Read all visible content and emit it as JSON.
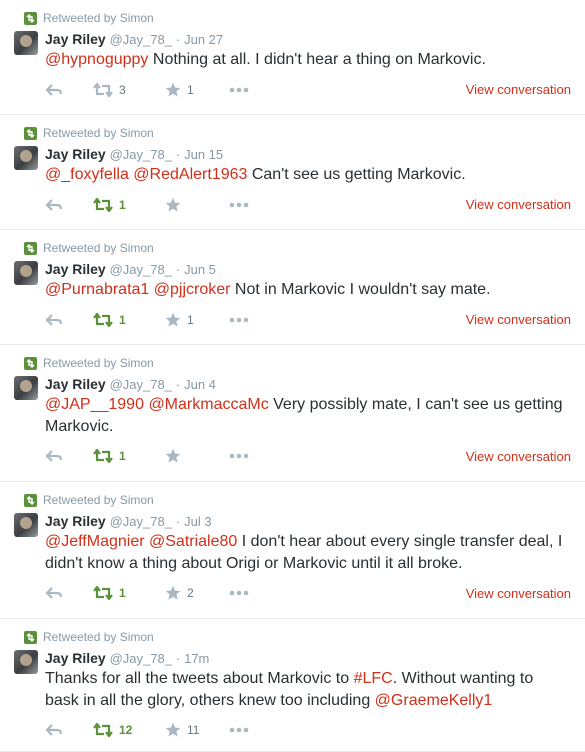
{
  "colors": {
    "link": "#d0301a",
    "muted": "#8899a6",
    "retweet_on": "#5c913b",
    "icon": "#aab8c2"
  },
  "icons": {
    "retweet_context": "retweet-icon",
    "reply": "reply-icon",
    "retweet": "retweet-icon",
    "favorite": "star-icon",
    "more": "more-dots-icon"
  },
  "tweets": [
    {
      "retweeted_by": "Retweeted by Simon",
      "fullname": "Jay Riley",
      "username": "@Jay_78_",
      "sep": "·",
      "time": "Jun 27",
      "parts": [
        {
          "t": "@hypnoguppy",
          "m": true
        },
        {
          "t": " Nothing at all. I didn't hear a thing on Markovic.",
          "m": false
        }
      ],
      "retweets": "3",
      "favorites": "1",
      "retweeted": false,
      "view_conversation": "View conversation"
    },
    {
      "retweeted_by": "Retweeted by Simon",
      "fullname": "Jay Riley",
      "username": "@Jay_78_",
      "sep": "·",
      "time": "Jun 15",
      "parts": [
        {
          "t": "@_foxyfella",
          "m": true
        },
        {
          "t": " ",
          "m": false
        },
        {
          "t": "@RedAlert1963",
          "m": true
        },
        {
          "t": " Can't see us getting Markovic.",
          "m": false
        }
      ],
      "retweets": "1",
      "favorites": "",
      "retweeted": true,
      "view_conversation": "View conversation"
    },
    {
      "retweeted_by": "Retweeted by Simon",
      "fullname": "Jay Riley",
      "username": "@Jay_78_",
      "sep": "·",
      "time": "Jun 5",
      "parts": [
        {
          "t": "@Purnabrata1",
          "m": true
        },
        {
          "t": " ",
          "m": false
        },
        {
          "t": "@pjjcroker",
          "m": true
        },
        {
          "t": " Not in Markovic I wouldn't say mate.",
          "m": false
        }
      ],
      "retweets": "1",
      "favorites": "1",
      "retweeted": true,
      "view_conversation": "View conversation"
    },
    {
      "retweeted_by": "Retweeted by Simon",
      "fullname": "Jay Riley",
      "username": "@Jay_78_",
      "sep": "·",
      "time": "Jun 4",
      "parts": [
        {
          "t": "@JAP__1990",
          "m": true
        },
        {
          "t": " ",
          "m": false
        },
        {
          "t": "@MarkmaccaMc",
          "m": true
        },
        {
          "t": " Very possibly mate, I can't see us getting Markovic.",
          "m": false
        }
      ],
      "retweets": "1",
      "favorites": "",
      "retweeted": true,
      "view_conversation": "View conversation"
    },
    {
      "retweeted_by": "Retweeted by Simon",
      "fullname": "Jay Riley",
      "username": "@Jay_78_",
      "sep": "·",
      "time": "Jul 3",
      "parts": [
        {
          "t": "@JeffMagnier",
          "m": true
        },
        {
          "t": " ",
          "m": false
        },
        {
          "t": "@Satriale80",
          "m": true
        },
        {
          "t": " I don't hear about every single transfer deal, I didn't know a thing about Origi or Markovic until it all broke.",
          "m": false
        }
      ],
      "retweets": "1",
      "favorites": "2",
      "retweeted": true,
      "view_conversation": "View conversation"
    },
    {
      "retweeted_by": "Retweeted by Simon",
      "fullname": "Jay Riley",
      "username": "@Jay_78_",
      "sep": "·",
      "time": "17m",
      "parts": [
        {
          "t": "Thanks for all the tweets about Markovic to ",
          "m": false
        },
        {
          "t": "#LFC",
          "m": true
        },
        {
          "t": ". Without wanting to bask in all the glory, others knew too including ",
          "m": false
        },
        {
          "t": "@GraemeKelly1",
          "m": true
        }
      ],
      "retweets": "12",
      "favorites": "11",
      "retweeted": true,
      "view_conversation": ""
    }
  ]
}
